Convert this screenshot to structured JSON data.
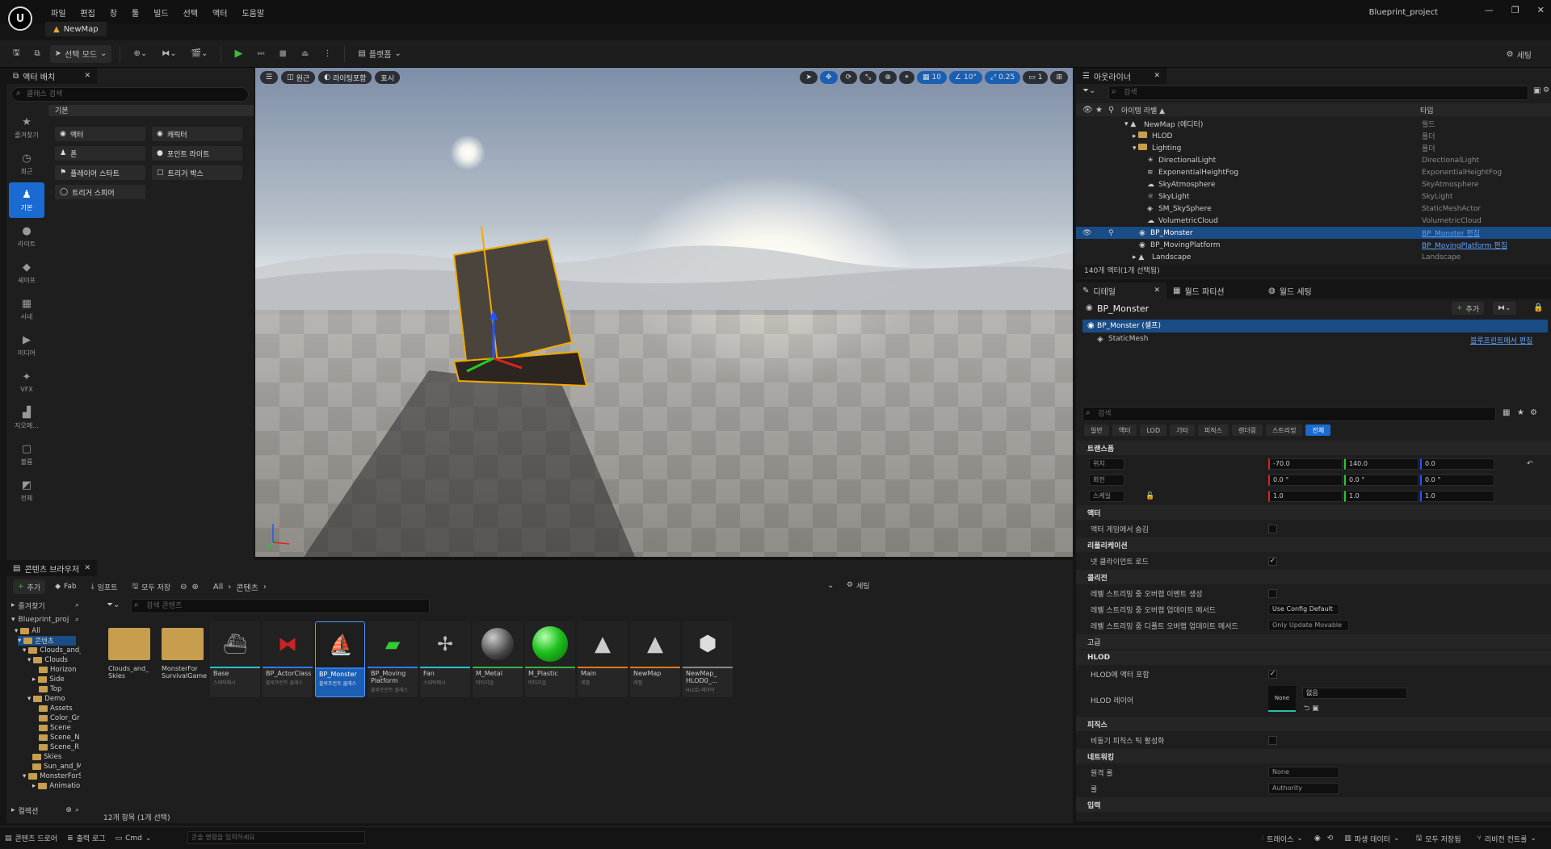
{
  "app": {
    "project": "Blueprint_project",
    "document_tab": "NewMap"
  },
  "menu": [
    "파일",
    "편집",
    "창",
    "툴",
    "빌드",
    "선택",
    "액터",
    "도움말"
  ],
  "window_controls": [
    "—",
    "❐",
    "✕"
  ],
  "toolbar": {
    "mode": "선택 모드",
    "platform": "플랫폼",
    "settings": "세팅"
  },
  "place_actors": {
    "title": "액터 배치",
    "search_placeholder": "클래스 검색",
    "category_header": "기본",
    "side": [
      {
        "label": "즐겨찾기"
      },
      {
        "label": "최근"
      },
      {
        "label": "기본"
      },
      {
        "label": "라이트"
      },
      {
        "label": "셰이프"
      },
      {
        "label": "시네"
      },
      {
        "label": "미디어"
      },
      {
        "label": "VFX"
      },
      {
        "label": "지오메..."
      },
      {
        "label": "볼륨"
      },
      {
        "label": "전체"
      }
    ],
    "items": [
      "액터",
      "캐릭터",
      "폰",
      "포인트 라이트",
      "플레이어 스타트",
      "트리거 박스",
      "트리거 스피어"
    ]
  },
  "viewport": {
    "perspective": "원근",
    "lighting": "라이팅포함",
    "show": "표시",
    "grid_snap": "10",
    "rot_snap": "10°",
    "scale_snap": "0.25",
    "camera_speed": "1"
  },
  "outliner": {
    "title": "아웃라이너",
    "search_placeholder": "검색",
    "col_label": "아이템 라벨 ▲",
    "col_type": "타입",
    "rows": [
      {
        "label": "NewMap (에디터)",
        "type": "월드"
      },
      {
        "label": "HLOD",
        "type": "폴더"
      },
      {
        "label": "Lighting",
        "type": "폴더"
      },
      {
        "label": "DirectionalLight",
        "type": "DirectionalLight"
      },
      {
        "label": "ExponentialHeightFog",
        "type": "ExponentialHeightFog"
      },
      {
        "label": "SkyAtmosphere",
        "type": "SkyAtmosphere"
      },
      {
        "label": "SkyLight",
        "type": "SkyLight"
      },
      {
        "label": "SM_SkySphere",
        "type": "StaticMeshActor"
      },
      {
        "label": "VolumetricCloud",
        "type": "VolumetricCloud"
      },
      {
        "label": "BP_Monster",
        "type": "BP_Monster 편집"
      },
      {
        "label": "BP_MovingPlatform",
        "type": "BP_MovingPlatform 편집"
      },
      {
        "label": "Landscape",
        "type": "Landscape"
      }
    ],
    "footer": "140개 액터(1개 선택됨)"
  },
  "details": {
    "tabs": [
      "디테일",
      "월드 파티션",
      "월드 세팅"
    ],
    "actor": "BP_Monster",
    "add_button": "추가",
    "self_row": "BP_Monster (셀프)",
    "component": "StaticMesh",
    "edit_blueprint": "블루프린트에서 편집",
    "search_placeholder": "검색",
    "categories": [
      "일반",
      "액터",
      "LOD",
      "기타",
      "피직스",
      "렌더링",
      "스트리밍",
      "전체"
    ],
    "sections": {
      "transform": "트랜스폼",
      "actor": "액터",
      "replication": "리플리케이션",
      "collision": "콜리전",
      "advanced": "고급",
      "hlod": "HLOD",
      "physics": "피직스",
      "networking": "네트워킹",
      "input": "입력"
    },
    "transform": {
      "location_label": "위치",
      "rotation_label": "회전",
      "scale_label": "스케일",
      "location": [
        "-70.0",
        "140.0",
        "0.0"
      ],
      "rotation": [
        "0.0 °",
        "0.0 °",
        "0.0 °"
      ],
      "scale": [
        "1.0",
        "1.0",
        "1.0"
      ]
    },
    "props": {
      "hidden_in_game": "액터 게임에서 숨김",
      "net_load_client": "넷 클라이언트 로드",
      "gen_overlap_events": "레벨 스트리밍 중 오버랩 이벤트 생성",
      "update_overlaps_method": "레벨 스트리밍 중 오버랩 업데이트 메서드",
      "update_overlaps_value": "Use Config Default",
      "default_update_method": "레벨 스트리밍 중 디폴트 오버랩 업데이트 메서드",
      "default_update_value": "Only Update Movable",
      "include_hlod": "HLOD에 액터 포함",
      "hlod_layer": "HLOD 레이어",
      "hlod_none": "None",
      "hlod_layer_value": "없음",
      "async_physics": "비동기 피직스 틱 활성화",
      "remote_role": "원격 롤",
      "remote_role_value": "None",
      "role": "롤",
      "role_value": "Authority"
    }
  },
  "content_browser": {
    "title": "콘텐츠 브라우저",
    "add": "추가",
    "fab": "Fab",
    "import": "임포트",
    "save_all": "모두 저장",
    "path": [
      "All",
      "콘텐츠"
    ],
    "settings": "세팅",
    "favorites": "즐겨찾기",
    "root": "Blueprint_proj",
    "search_placeholder": "검색 콘텐츠",
    "collections": "컬렉션",
    "count": "12개 항목 (1개 선택)",
    "tree": [
      "All",
      "콘텐츠",
      "Clouds_and_",
      "Clouds",
      "Horizon",
      "Side",
      "Top",
      "Demo",
      "Assets",
      "Color_Gr",
      "Scene",
      "Scene_N",
      "Scene_R",
      "Skies",
      "Sun_and_M",
      "MonsterForS",
      "Animation"
    ],
    "assets": [
      {
        "name": "Clouds_and_ Skies",
        "type": ""
      },
      {
        "name": "MonsterFor SurvivalGame",
        "type": ""
      },
      {
        "name": "Base",
        "type": "스태틱메시"
      },
      {
        "name": "BP_ActorClass",
        "type": "블루프린트 클래스"
      },
      {
        "name": "BP_Monster",
        "type": "블루프린트 클래스"
      },
      {
        "name": "BP_Moving Platform",
        "type": "블루프린트 클래스"
      },
      {
        "name": "Fan",
        "type": "스태틱메시"
      },
      {
        "name": "M_Metal",
        "type": "머티리얼"
      },
      {
        "name": "M_Plastic",
        "type": "머티리얼"
      },
      {
        "name": "Main",
        "type": "레벨"
      },
      {
        "name": "NewMap",
        "type": "레벨"
      },
      {
        "name": "NewMap_ HLOD0_...",
        "type": "HLOD 레이어"
      }
    ]
  },
  "statusbar": {
    "content_drawer": "콘텐츠 드로어",
    "output_log": "출력 로그",
    "cmd": "Cmd",
    "console_placeholder": "콘솔 명령을 입력하세요",
    "trace": "트레이스",
    "derived_data": "파생 데이터",
    "save_all": "모두 저장됨",
    "revision": "리비전 컨트롤"
  },
  "colors": {
    "accent": "#1a6bd1",
    "selection": "#1a4c85",
    "play": "#3cbd3c",
    "gizmo_x": "#d22",
    "gizmo_y": "#2c2",
    "gizmo_z": "#25f",
    "select_outline": "#f2a900"
  }
}
